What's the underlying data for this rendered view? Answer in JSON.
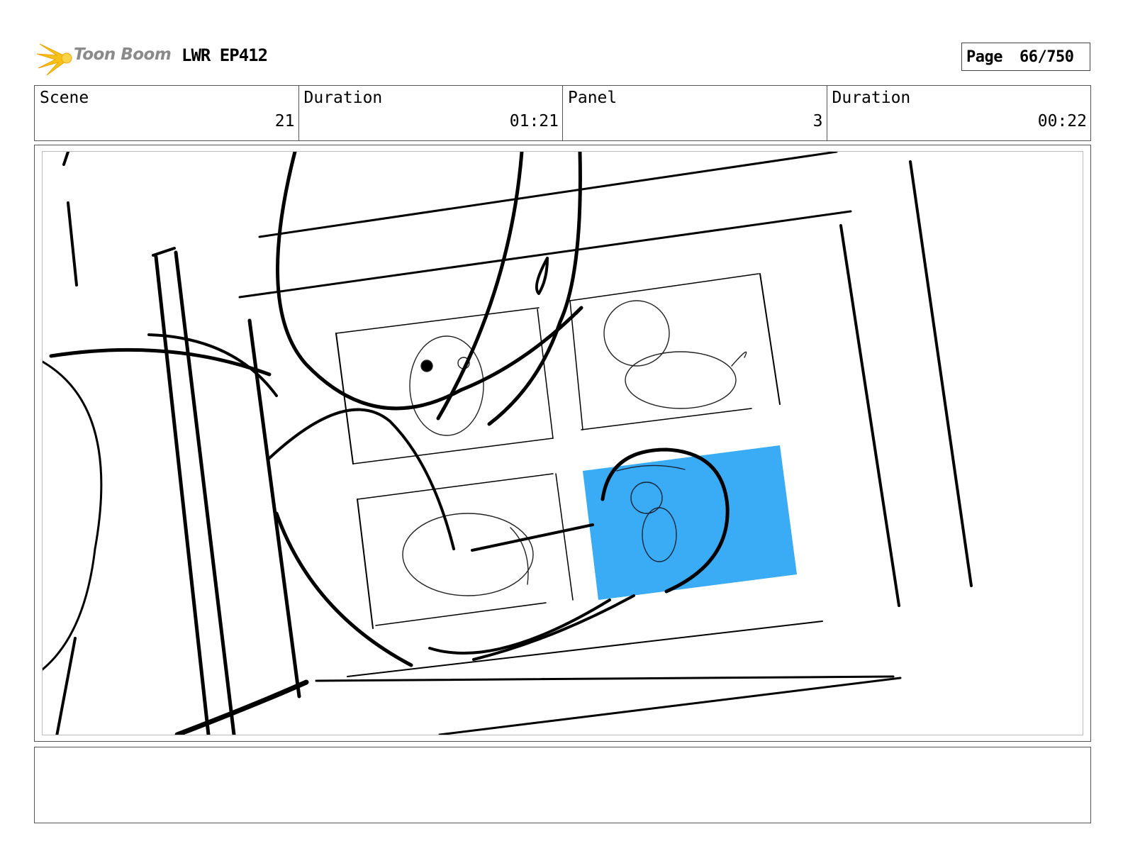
{
  "header": {
    "logo_text": "Toon Boom",
    "project_title": "LWR EP412",
    "page_label": "Page",
    "page_value": "66/750"
  },
  "info": {
    "scene_label": "Scene",
    "scene_value": "21",
    "duration_label": "Duration",
    "duration_value": "01:21",
    "panel_label": "Panel",
    "panel_value": "3",
    "panel_duration_label": "Duration",
    "panel_duration_value": "00:22"
  },
  "panel": {
    "drawing": "storyboard sketch",
    "highlight_color": "#3aabf5"
  },
  "notes": {
    "text": ""
  }
}
